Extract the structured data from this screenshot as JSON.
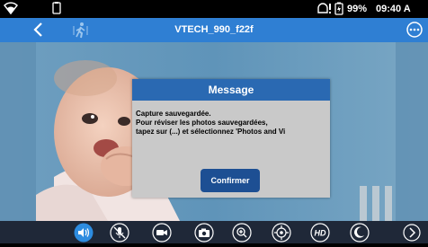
{
  "status_bar": {
    "battery": "99%",
    "time": "09:40 A",
    "icons": [
      "wifi-icon",
      "phone-icon",
      "notification-icon",
      "battery-icon"
    ]
  },
  "title_bar": {
    "title": "VTECH_990_f22f",
    "back_icon": "back-chevron-icon",
    "left_icon": "walking-person-icon",
    "right_icon": "more-options-icon",
    "color": "#2f7fd3"
  },
  "dialog": {
    "title": "Message",
    "line1": "Capture sauvegardée.",
    "line2": "Pour réviser les photos sauvegardées,",
    "line3": "tapez sur (...) et sélectionnez 'Photos and Vi",
    "confirm_label": "Confirmer",
    "header_color": "#2a69b2",
    "button_color": "#1d4f93"
  },
  "toolbar": {
    "items": [
      {
        "icon": "speaker-icon",
        "active": true
      },
      {
        "icon": "mic-muted-icon",
        "active": false
      },
      {
        "icon": "video-camera-icon",
        "active": false
      },
      {
        "icon": "camera-icon",
        "active": false
      },
      {
        "icon": "zoom-in-icon",
        "active": false
      },
      {
        "icon": "pan-tilt-icon",
        "active": false
      },
      {
        "icon": "hd-icon",
        "label": "HD",
        "active": false
      },
      {
        "icon": "night-mode-icon",
        "active": false
      },
      {
        "icon": "next-arrow-icon",
        "active": false
      }
    ]
  }
}
